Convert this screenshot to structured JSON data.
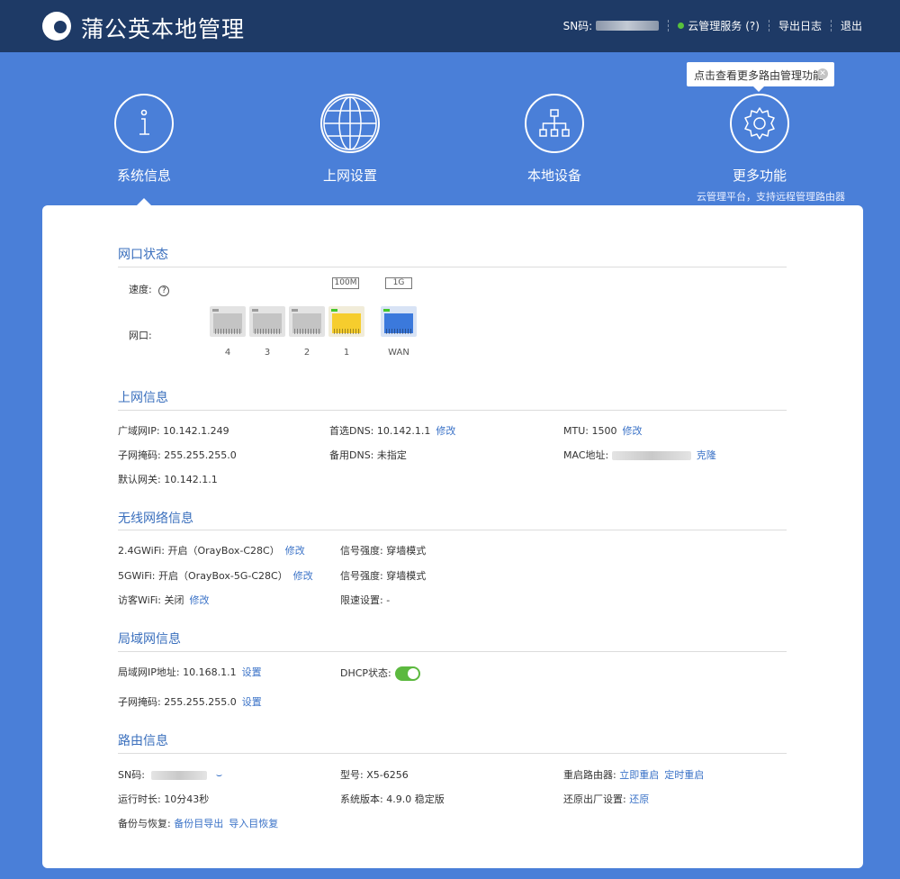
{
  "header": {
    "brand": "蒲公英本地管理",
    "sn_label": "SN码:",
    "cloud_service": "云管理服务",
    "cloud_help": "(?)",
    "export_log": "导出日志",
    "logout": "退出"
  },
  "nav": {
    "items": [
      {
        "label": "系统信息",
        "icon": "info-icon"
      },
      {
        "label": "上网设置",
        "icon": "globe-icon"
      },
      {
        "label": "本地设备",
        "icon": "network-tree-icon"
      },
      {
        "label": "更多功能",
        "icon": "gear-icon",
        "sub": "云管理平台，支持远程管理路由器"
      }
    ],
    "tooltip": "点击查看更多路由管理功能"
  },
  "port_status": {
    "title": "网口状态",
    "speed_label": "速度:",
    "port_label": "网口:",
    "speed_tags": [
      "100M",
      "1G"
    ],
    "ports": [
      {
        "name": "4",
        "state": "gray"
      },
      {
        "name": "3",
        "state": "gray"
      },
      {
        "name": "2",
        "state": "gray"
      },
      {
        "name": "1",
        "state": "yellow"
      },
      {
        "name": "WAN",
        "state": "blue"
      }
    ]
  },
  "internet": {
    "title": "上网信息",
    "wan_ip_label": "广域网IP:",
    "wan_ip": "10.142.1.249",
    "subnet_label": "子网掩码:",
    "subnet": "255.255.255.0",
    "gateway_label": "默认网关:",
    "gateway": "10.142.1.1",
    "dns1_label": "首选DNS:",
    "dns1": "10.142.1.1",
    "dns1_action": "修改",
    "dns2_label": "备用DNS:",
    "dns2": "未指定",
    "mtu_label": "MTU:",
    "mtu": "1500",
    "mtu_action": "修改",
    "mac_label": "MAC地址:",
    "mac_action": "克隆"
  },
  "wireless": {
    "title": "无线网络信息",
    "wifi24_label": "2.4GWiFi:",
    "wifi24": "开启（OrayBox-C28C）",
    "wifi24_action": "修改",
    "wifi5_label": "5GWiFi:",
    "wifi5": "开启（OrayBox-5G-C28C）",
    "wifi5_action": "修改",
    "guest_label": "访客WiFi:",
    "guest": "关闭",
    "guest_action": "修改",
    "signal1_label": "信号强度:",
    "signal1": "穿墙模式",
    "signal2_label": "信号强度:",
    "signal2": "穿墙模式",
    "limit_label": "限速设置:",
    "limit": "-"
  },
  "lan": {
    "title": "局域网信息",
    "ip_label": "局域网IP地址:",
    "ip": "10.168.1.1",
    "ip_action": "设置",
    "subnet_label": "子网掩码:",
    "subnet": "255.255.255.0",
    "subnet_action": "设置",
    "dhcp_label": "DHCP状态:",
    "dhcp_on": true
  },
  "router": {
    "title": "路由信息",
    "sn_label": "SN码:",
    "uptime_label": "运行时长:",
    "uptime": "10分43秒",
    "backup_label": "备份与恢复:",
    "backup_export": "备份目导出",
    "backup_import": "导入目恢复",
    "model_label": "型号:",
    "model": "X5-6256",
    "version_label": "系统版本:",
    "version": "4.9.0 稳定版",
    "reboot_label": "重启路由器:",
    "reboot_now": "立即重启",
    "reboot_timer": "定时重启",
    "reset_label": "还原出厂设置:",
    "reset_action": "还原"
  }
}
